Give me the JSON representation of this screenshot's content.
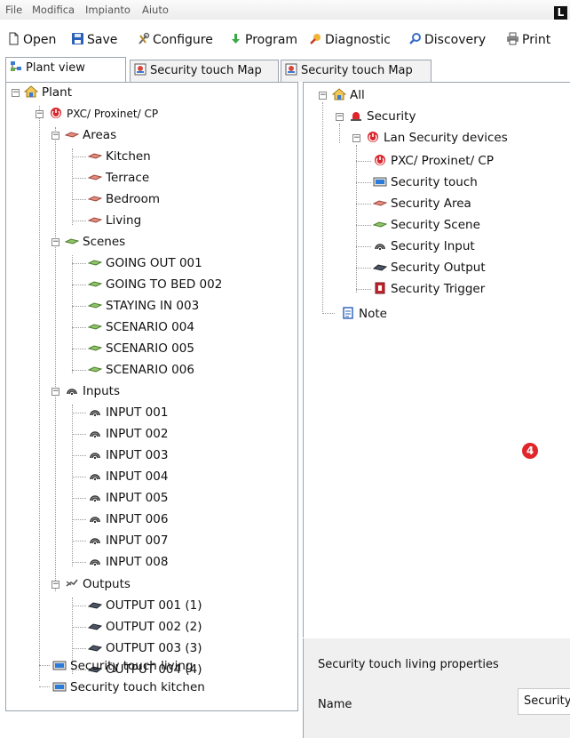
{
  "menu": [
    "File",
    "Modifica",
    "Impianto",
    "Aiuto"
  ],
  "corner_badge": "L",
  "toolbar": {
    "open": "Open",
    "save": "Save",
    "configure": "Configure",
    "program": "Program",
    "diagnostic": "Diagnostic",
    "discovery": "Discovery",
    "print": "Print"
  },
  "tabs": [
    "Plant view",
    "Security touch Map",
    "Security touch Map"
  ],
  "left_tree": {
    "plant": "Plant",
    "pxc": "PXC/ Proxinet/ CP",
    "areas": "Areas",
    "area_items": [
      "Kitchen",
      "Terrace",
      "Bedroom",
      "Living"
    ],
    "scenes": "Scenes",
    "scene_items": [
      "GOING OUT 001",
      "GOING TO BED 002",
      "STAYING IN 003",
      "SCENARIO      004",
      "SCENARIO      005",
      "SCENARIO      006"
    ],
    "inputs": "Inputs",
    "input_items": [
      "INPUT    001",
      "INPUT    002",
      "INPUT    003",
      "INPUT    004",
      "INPUT    005",
      "INPUT    006",
      "INPUT    007",
      "INPUT    008"
    ],
    "outputs": "Outputs",
    "output_items": [
      "OUTPUT    001 (1)",
      "OUTPUT    002 (2)",
      "OUTPUT    003 (3)",
      "OUTPUT    004 (4)"
    ],
    "touch_living": "Security touch living",
    "touch_kitchen": "Security touch kitchen"
  },
  "right_tree": {
    "all": "All",
    "security": "Security",
    "lan": "Lan Security devices",
    "items": [
      "PXC/ Proxinet/ CP",
      "Security touch",
      "Security Area",
      "Security Scene",
      "Security Input",
      "Security Output",
      "Security Trigger"
    ],
    "note": "Note"
  },
  "callout": "4",
  "properties": {
    "title": "Security touch living properties",
    "name_label": "Name",
    "name_value": "Security touch living"
  }
}
